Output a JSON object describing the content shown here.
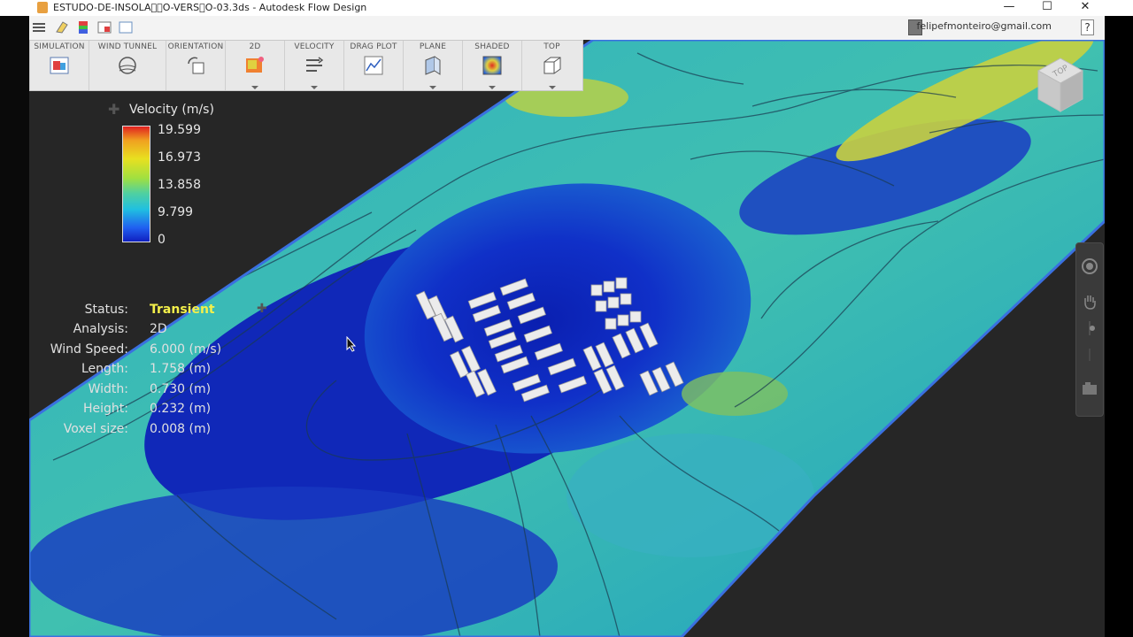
{
  "window": {
    "title": "ESTUDO-DE-INSOLA\u0000\u0000O-VERS\u0000O-03.3ds - Autodesk Flow Design",
    "minimize": "—",
    "maximize": "☐",
    "close": "✕"
  },
  "account": {
    "email": "felipefmonteiro@gmail.com",
    "help": "?"
  },
  "ribbon": {
    "buttons": [
      {
        "label": "SIMULATION",
        "icon": "simulation-icon",
        "dropdown": false
      },
      {
        "label": "WIND TUNNEL",
        "icon": "wind-tunnel-icon",
        "dropdown": false
      },
      {
        "label": "ORIENTATION",
        "icon": "orientation-icon",
        "dropdown": false
      },
      {
        "label": "2D",
        "icon": "2d-icon",
        "dropdown": true
      },
      {
        "label": "VELOCITY",
        "icon": "velocity-icon",
        "dropdown": true
      },
      {
        "label": "DRAG PLOT",
        "icon": "drag-plot-icon",
        "dropdown": false
      },
      {
        "label": "PLANE",
        "icon": "plane-icon",
        "dropdown": true
      },
      {
        "label": "SHADED",
        "icon": "shaded-icon",
        "dropdown": true
      },
      {
        "label": "TOP",
        "icon": "top-view-icon",
        "dropdown": true
      }
    ]
  },
  "legend": {
    "title": "Velocity (m/s)",
    "ticks": [
      "19.599",
      "16.973",
      "13.858",
      "9.799",
      "0"
    ],
    "colors": [
      "#e02020",
      "#f0a020",
      "#e8e020",
      "#a0e040",
      "#50d0a0",
      "#20c0e0",
      "#2060f0",
      "#1020c0"
    ]
  },
  "info": {
    "status_label": "Status:",
    "status_value": "Transient",
    "analysis_label": "Analysis:",
    "analysis_value": "2D",
    "wind_label": "Wind Speed:",
    "wind_value": "6.000 (m/s)",
    "length_label": "Length:",
    "length_value": "1.758 (m)",
    "width_label": "Width:",
    "width_value": "0.730 (m)",
    "height_label": "Height:",
    "height_value": "0.232 (m)",
    "voxel_label": "Voxel size:",
    "voxel_value": "0.008 (m)"
  },
  "viewcube": {
    "face": "TOP"
  },
  "status_color": "#f4f04a"
}
